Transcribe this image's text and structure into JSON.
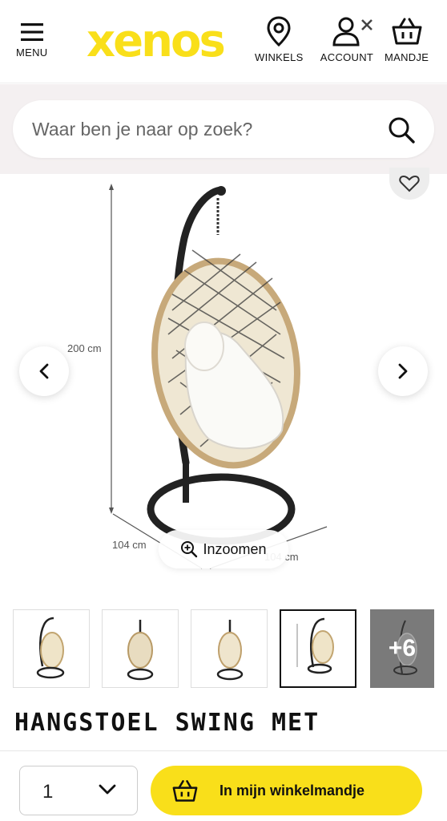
{
  "header": {
    "menu_label": "MENU",
    "logo_text": "xenos",
    "stores_label": "WINKELS",
    "account_label": "ACCOUNT",
    "cart_label": "MANDJE",
    "brand_color": "#f9df1a"
  },
  "search": {
    "placeholder": "Waar ben je naar op zoek?"
  },
  "gallery": {
    "dimension_height": "200 cm",
    "dimension_width": "104 cm",
    "dimension_depth": "104 cm",
    "zoom_label": "Inzoomen",
    "more_images_label": "+6",
    "active_thumbnail": 4
  },
  "product": {
    "title": "HANGSTOEL SWING MET STANDAARD - NATUREL"
  },
  "purchase": {
    "quantity": "1",
    "add_to_cart_label": "In mijn winkelmandje"
  },
  "icons": [
    "menu-icon",
    "map-pin-icon",
    "user-icon",
    "close-icon",
    "basket-icon",
    "search-icon",
    "heart-icon",
    "chevron-left-icon",
    "chevron-right-icon",
    "zoom-in-icon",
    "chevron-down-icon"
  ]
}
